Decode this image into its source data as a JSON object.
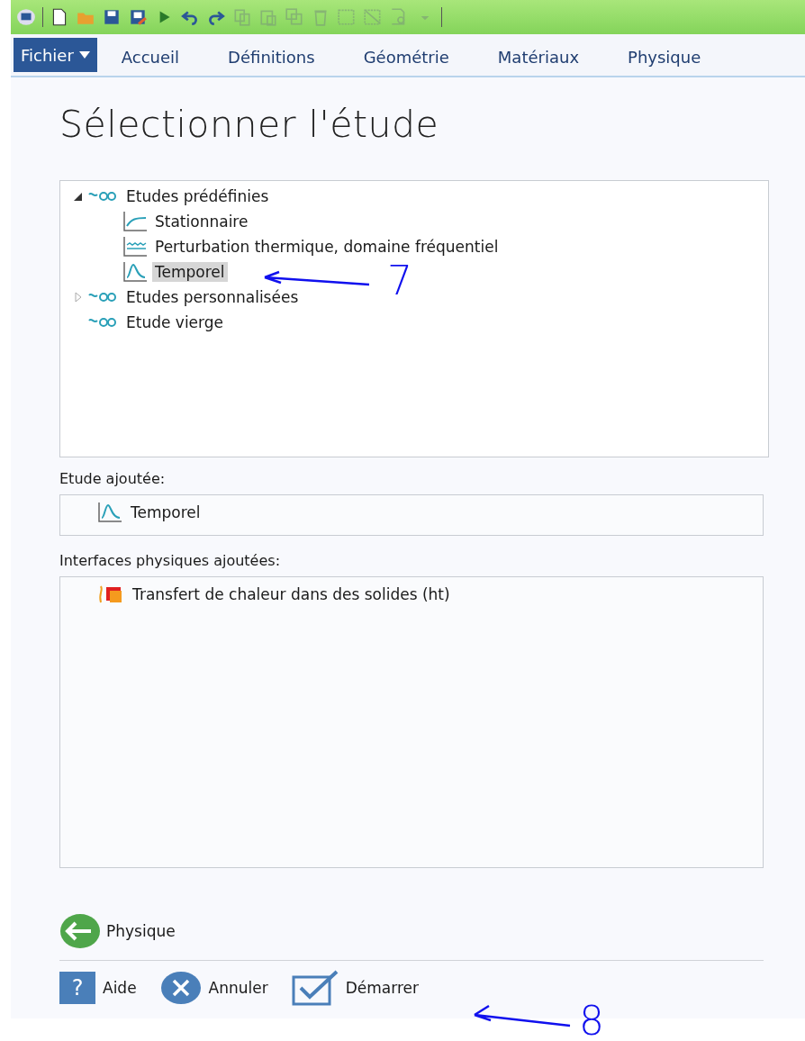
{
  "toolbar": {
    "items": [
      {
        "kind": "app"
      },
      {
        "kind": "sep"
      },
      {
        "kind": "new"
      },
      {
        "kind": "open"
      },
      {
        "kind": "save"
      },
      {
        "kind": "saveas"
      },
      {
        "kind": "run"
      },
      {
        "kind": "undo"
      },
      {
        "kind": "redo"
      },
      {
        "kind": "copy",
        "disabled": true
      },
      {
        "kind": "paste",
        "disabled": true
      },
      {
        "kind": "duplicate",
        "disabled": true
      },
      {
        "kind": "delete",
        "disabled": true
      },
      {
        "kind": "select",
        "disabled": true
      },
      {
        "kind": "deselect",
        "disabled": true
      },
      {
        "kind": "find",
        "disabled": true
      },
      {
        "kind": "more",
        "disabled": true
      },
      {
        "kind": "sep"
      }
    ]
  },
  "ribbon_tabs": [
    {
      "label": "Fichier",
      "kind": "menu"
    },
    {
      "label": "Accueil",
      "kind": "tab"
    },
    {
      "label": "Définitions",
      "kind": "tab"
    },
    {
      "label": "Géométrie",
      "kind": "tab"
    },
    {
      "label": "Matériaux",
      "kind": "tab"
    },
    {
      "label": "Physique",
      "kind": "tab"
    }
  ],
  "title": "Sélectionner l'étude",
  "study_tree": [
    {
      "label": "Etudes prédéfinies",
      "kind": "folder",
      "expanded": true,
      "selected": false,
      "children": [
        {
          "label": "Stationnaire",
          "kind": "stationary",
          "selected": false
        },
        {
          "label": "Perturbation thermique, domaine fréquentiel",
          "kind": "frequency",
          "selected": false
        },
        {
          "label": "Temporel",
          "kind": "transient",
          "selected": true
        }
      ]
    },
    {
      "label": "Etudes personnalisées",
      "kind": "folder",
      "expanded": false,
      "selected": false
    },
    {
      "label": "Etude vierge",
      "kind": "leaf-folder",
      "selected": false
    }
  ],
  "added_study": {
    "label": "Etude ajoutée:",
    "items": [
      {
        "label": "Temporel",
        "kind": "transient"
      }
    ]
  },
  "added_physics": {
    "label": "Interfaces physiques ajoutées:",
    "items": [
      {
        "label": "Transfert de chaleur dans des solides (ht)",
        "kind": "heat"
      }
    ]
  },
  "back_button": {
    "label": "Physique"
  },
  "buttons": [
    {
      "label": "Aide",
      "kind": "help",
      "icon_text": "?"
    },
    {
      "label": "Annuler",
      "kind": "cancel"
    },
    {
      "label": "Démarrer",
      "kind": "start"
    }
  ],
  "annotations": [
    {
      "label": "7"
    },
    {
      "label": "8"
    }
  ]
}
